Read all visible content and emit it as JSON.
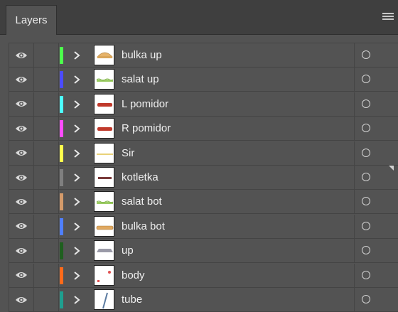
{
  "panel": {
    "tab_label": "Layers"
  },
  "icons": {
    "visibility": "eye-icon",
    "expand": "chevron-right-icon",
    "target": "target-circle-icon",
    "menu": "panel-menu-icon"
  },
  "layers": [
    {
      "name": "bulka up",
      "color": "#4cff4c",
      "thumb": "bun-top"
    },
    {
      "name": "salat up",
      "color": "#4b4bff",
      "thumb": "lettuce"
    },
    {
      "name": "L pomidor",
      "color": "#4cffff",
      "thumb": "tomato"
    },
    {
      "name": "R pomidor",
      "color": "#ff4cff",
      "thumb": "tomato"
    },
    {
      "name": "Sir",
      "color": "#ffff4c",
      "thumb": "cheese"
    },
    {
      "name": "kotletka",
      "color": "#7f7f7f",
      "thumb": "patty"
    },
    {
      "name": "salat bot",
      "color": "#d39a6a",
      "thumb": "lettuce"
    },
    {
      "name": "bulka bot",
      "color": "#4f7fff",
      "thumb": "bun-bottom"
    },
    {
      "name": "up",
      "color": "#1f5f1f",
      "thumb": "lid"
    },
    {
      "name": "body",
      "color": "#ff6a1a",
      "thumb": "body"
    },
    {
      "name": "tube",
      "color": "#1f9f8f",
      "thumb": "tube"
    }
  ]
}
